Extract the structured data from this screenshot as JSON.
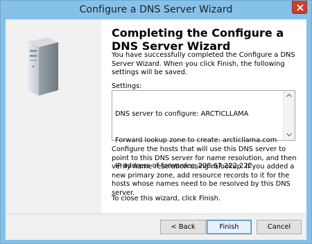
{
  "window": {
    "title": "Configure a DNS Server Wizard"
  },
  "icons": {
    "close": "close-icon",
    "server": "server-illustration-icon",
    "scroll_up": "chevron-up-icon",
    "scroll_down": "chevron-down-icon"
  },
  "colors": {
    "titlebar": "#86c1ea",
    "close_button": "#c7432e",
    "left_panel": "#f1f1f1",
    "footer": "#f0f0f0"
  },
  "content": {
    "heading": "Completing the Configure a DNS Server Wizard",
    "intro": "You have successfully completed the Configure a DNS Server Wizard. When you click Finish, the following settings will be saved.",
    "settings_label": "Settings:",
    "settings_lines": [
      "DNS server to configure: ARCTICLLAMA",
      "Forward lookup zone to create: arcticllama.com",
      "IP address of forwarder: 208.67.222.222"
    ],
    "configure_note": "Configure the hosts that will use this DNS server to point to this DNS server for name resolution, and then verify name resolution using nslookup. If you added a new primary zone, add resource records to it for the hosts whose names need to be resolved by this DNS server.",
    "close_note": "To close this wizard, click Finish."
  },
  "buttons": {
    "back": "< Back",
    "finish": "Finish",
    "cancel": "Cancel"
  }
}
